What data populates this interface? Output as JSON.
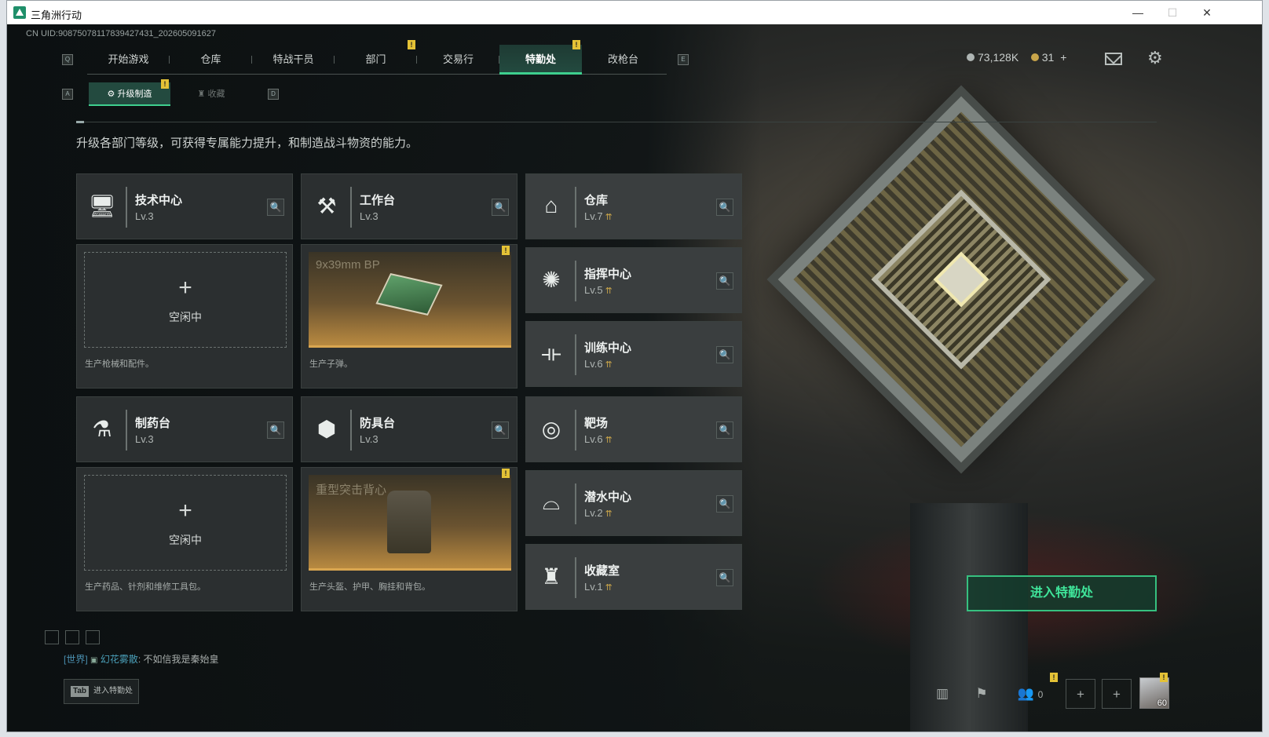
{
  "window": {
    "title": "三角洲行动",
    "minimize": "—",
    "maximize": "☐",
    "close": "✕"
  },
  "uid": "CN UID:9087507811783942743​1_202605091627",
  "keyhints": {
    "left": "Q",
    "right": "E",
    "sub_left": "A",
    "sub_right": "D"
  },
  "tabs": [
    {
      "label": "开始游戏"
    },
    {
      "label": "仓库"
    },
    {
      "label": "特战干员"
    },
    {
      "label": "部门"
    },
    {
      "label": "交易行"
    },
    {
      "label": "特勤处"
    },
    {
      "label": "改枪台"
    }
  ],
  "badge": "!",
  "currency": {
    "money": "73,128K",
    "coins": "31",
    "add": "+"
  },
  "subtabs": [
    {
      "label": "升级制造"
    },
    {
      "label": "收藏"
    }
  ],
  "description": "升级各部门等级，可获得专属能力提升，和制造战斗物资的能力。",
  "departments": [
    {
      "name": "技术中心",
      "level": "Lv.3",
      "icon": "monitor-icon",
      "glyph": "🖥"
    },
    {
      "name": "工作台",
      "level": "Lv.3",
      "icon": "hammer-wrench-icon",
      "glyph": "⚒"
    },
    {
      "name": "仓库",
      "level": "Lv.7",
      "icon": "warehouse-icon",
      "glyph": "⌂",
      "upgrade": "⇈"
    },
    {
      "name": "指挥中心",
      "level": "Lv.5",
      "icon": "command-icon",
      "glyph": "✺",
      "upgrade": "⇈"
    },
    {
      "name": "训练中心",
      "level": "Lv.6",
      "icon": "dumbbell-icon",
      "glyph": "⟛",
      "upgrade": "⇈"
    },
    {
      "name": "制药台",
      "level": "Lv.3",
      "icon": "microscope-icon",
      "glyph": "⚗"
    },
    {
      "name": "防具台",
      "level": "Lv.3",
      "icon": "armor-cubes-icon",
      "glyph": "⬢"
    },
    {
      "name": "靶场",
      "level": "Lv.6",
      "icon": "target-icon",
      "glyph": "◎",
      "upgrade": "⇈"
    },
    {
      "name": "潜水中心",
      "level": "Lv.2",
      "icon": "diving-mask-icon",
      "glyph": "⌓",
      "upgrade": "⇈"
    },
    {
      "name": "收藏室",
      "level": "Lv.1",
      "icon": "collection-icon",
      "glyph": "♜",
      "upgrade": "⇈"
    }
  ],
  "slots": [
    {
      "status": "空闲中",
      "plus": "+",
      "caption": "生产枪械和配件。"
    },
    {
      "item": "9x39mm BP",
      "caption": "生产子弹。"
    },
    {
      "status": "空闲中",
      "plus": "+",
      "caption": "生产药品、针剂和维修工具包。"
    },
    {
      "item": "重型突击背心",
      "caption": "生产头盔、护甲、胸挂和背包。"
    }
  ],
  "search_glyph": "🔍",
  "enter_button": "进入特勤处",
  "chat": {
    "channel": "[世界]",
    "user": "幻花雾散",
    "message": "不如信我是秦始皇"
  },
  "tab_hint": {
    "key": "Tab",
    "label": "进入特勤处"
  },
  "bottom_bar": {
    "friends": "0",
    "level": "60"
  },
  "colors": {
    "accent": "#3ecf8e",
    "badge": "#e4c236",
    "upgrade": "#c9a54a"
  }
}
